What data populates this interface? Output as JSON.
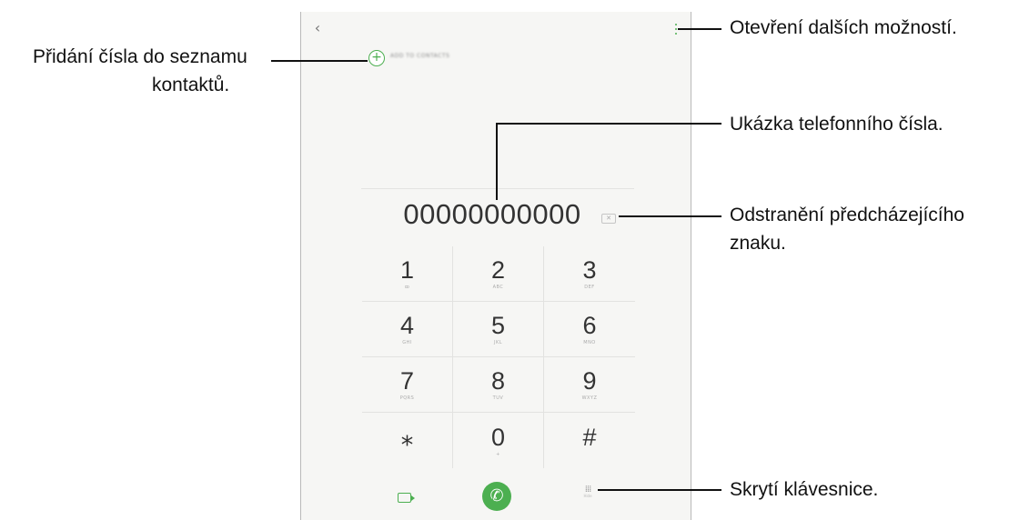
{
  "phone": {
    "header": {
      "back_icon": "chevron-left-icon",
      "more_icon": "more-vertical-icon"
    },
    "add_to_contacts": {
      "icon": "plus-circle-icon",
      "label": "ADD TO CONTACTS"
    },
    "number_display": "00000000000",
    "backspace_icon": "backspace-icon",
    "keys": [
      {
        "digit": "1",
        "sub": "ꝏ"
      },
      {
        "digit": "2",
        "sub": "ABC"
      },
      {
        "digit": "3",
        "sub": "DEF"
      },
      {
        "digit": "4",
        "sub": "GHI"
      },
      {
        "digit": "5",
        "sub": "JKL"
      },
      {
        "digit": "6",
        "sub": "MNO"
      },
      {
        "digit": "7",
        "sub": "PQRS"
      },
      {
        "digit": "8",
        "sub": "TUV"
      },
      {
        "digit": "9",
        "sub": "WXYZ"
      },
      {
        "digit": "⁎",
        "sub": ""
      },
      {
        "digit": "0",
        "sub": "+"
      },
      {
        "digit": "#",
        "sub": ""
      }
    ],
    "bottom_bar": {
      "video_icon": "video-call-icon",
      "call_icon": "phone-icon",
      "hide_keypad_icon": "dialpad-icon",
      "hide_label": "Hide"
    },
    "accent_color": "#4caf50"
  },
  "annotations": {
    "more_options": "Otevření dalších možností.",
    "add_contact_line1": "Přidání čísla do seznamu",
    "add_contact_line2": "kontaktů.",
    "number_preview": "Ukázka telefonního čísla.",
    "delete_prev_line1": "Odstranění předcházejícího",
    "delete_prev_line2": "znaku.",
    "hide_keypad": "Skrytí klávesnice."
  }
}
